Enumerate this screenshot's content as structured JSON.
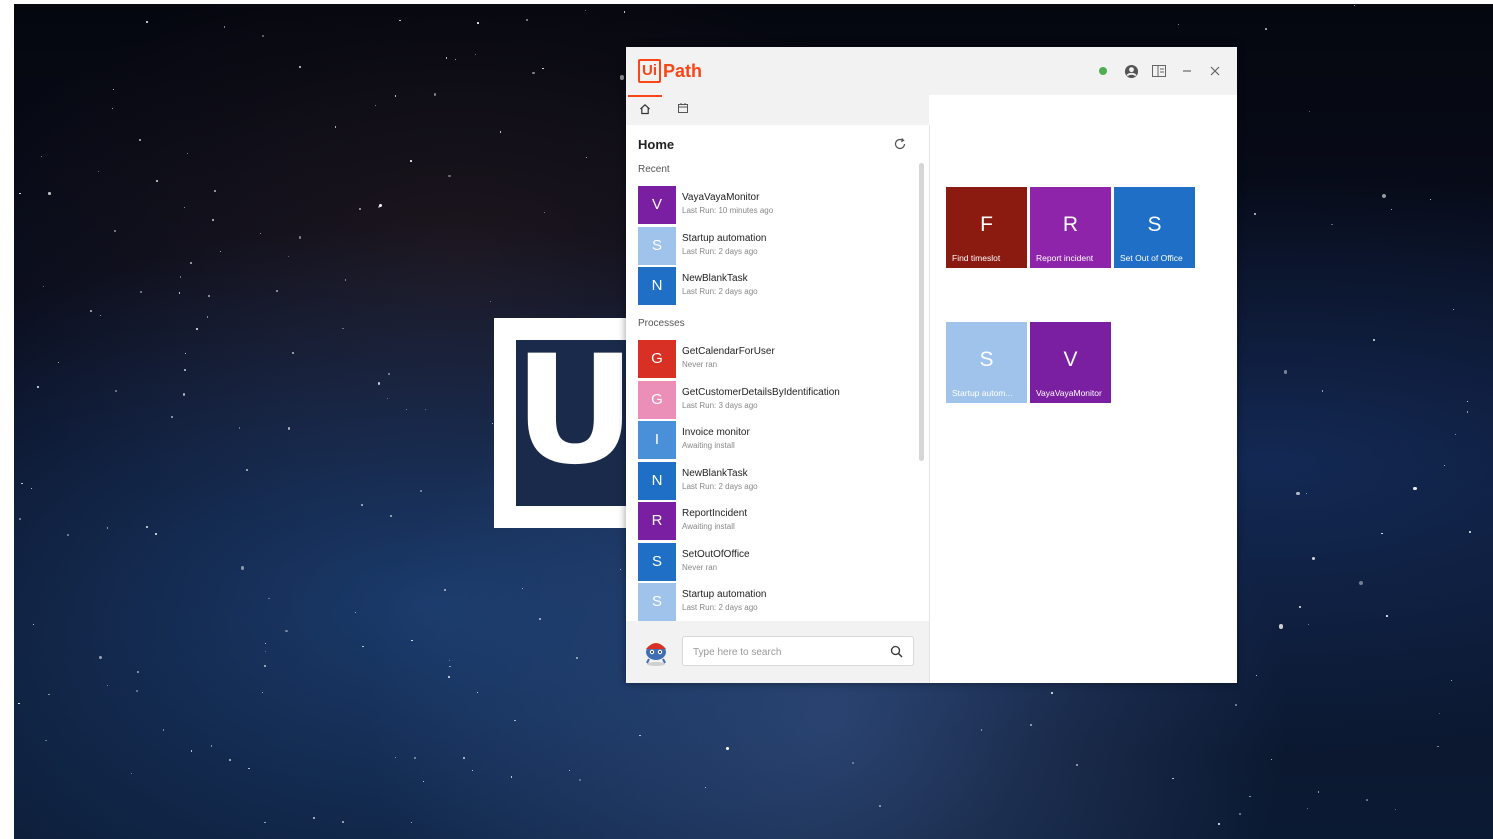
{
  "window": {
    "logo_box": "Ui",
    "logo_text": "Path",
    "status_color": "#4caf50"
  },
  "home": {
    "title": "Home",
    "recent_label": "Recent",
    "processes_label": "Processes"
  },
  "recent": [
    {
      "letter": "V",
      "name": "VayaVayaMonitor",
      "status": "Last Run: 10 minutes ago",
      "color": "#7b1fa2"
    },
    {
      "letter": "S",
      "name": "Startup automation",
      "status": "Last Run: 2 days ago",
      "color": "#9fc3ea"
    },
    {
      "letter": "N",
      "name": "NewBlankTask",
      "status": "Last Run: 2 days ago",
      "color": "#1e6fc5"
    }
  ],
  "processes": [
    {
      "letter": "G",
      "name": "GetCalendarForUser",
      "status": "Never ran",
      "color": "#d93025"
    },
    {
      "letter": "G",
      "name": "GetCustomerDetailsByIdentification",
      "status": "Last Run: 3 days ago",
      "color": "#ec8fb8"
    },
    {
      "letter": "I",
      "name": "Invoice monitor",
      "status": "Awaiting install",
      "color": "#4a90d9"
    },
    {
      "letter": "N",
      "name": "NewBlankTask",
      "status": "Last Run: 2 days ago",
      "color": "#1e6fc5"
    },
    {
      "letter": "R",
      "name": "ReportIncident",
      "status": "Awaiting install",
      "color": "#7b1fa2"
    },
    {
      "letter": "S",
      "name": "SetOutOfOffice",
      "status": "Never ran",
      "color": "#1e6fc5"
    },
    {
      "letter": "S",
      "name": "Startup automation",
      "status": "Last Run: 2 days ago",
      "color": "#9fc3ea"
    }
  ],
  "search": {
    "placeholder": "Type here to search"
  },
  "tiles": [
    {
      "letter": "F",
      "label": "Find timeslot",
      "color": "#8b1a10"
    },
    {
      "letter": "R",
      "label": "Report incident",
      "color": "#8e24aa"
    },
    {
      "letter": "S",
      "label": "Set Out of Office",
      "color": "#1e6fc5"
    },
    {
      "letter": "S",
      "label": "Startup autom...",
      "color": "#9fc3ea"
    },
    {
      "letter": "V",
      "label": "VayaVayaMonitor",
      "color": "#7b1fa2"
    }
  ]
}
